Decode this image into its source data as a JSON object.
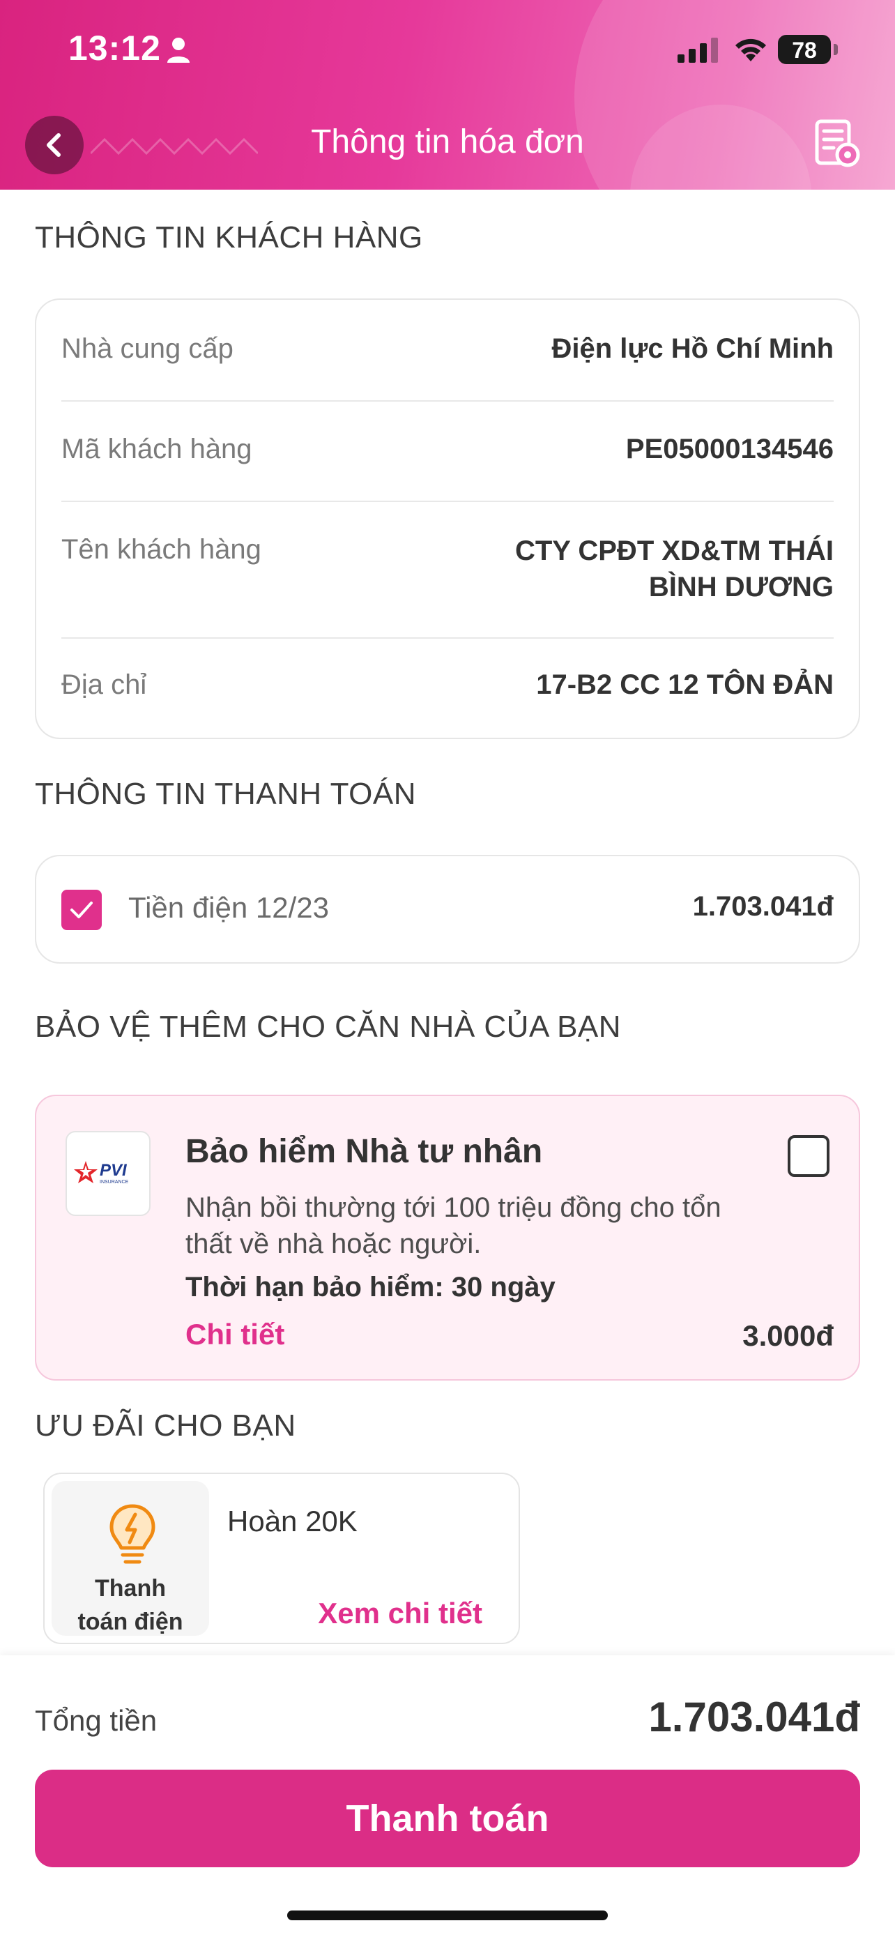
{
  "status_bar": {
    "time": "13:12",
    "battery": "78"
  },
  "header": {
    "title": "Thông tin hóa đơn"
  },
  "customer_section": {
    "title": "THÔNG TIN KHÁCH HÀNG",
    "rows": [
      {
        "label": "Nhà cung cấp",
        "value": "Điện lực Hồ Chí Minh"
      },
      {
        "label": "Mã khách hàng",
        "value": "PE05000134546"
      },
      {
        "label": "Tên khách hàng",
        "value_line1": "CTY CPĐT XD&TM THÁI",
        "value_line2": "BÌNH DƯƠNG"
      },
      {
        "label": "Địa chỉ",
        "value": "17-B2 CC 12 TÔN ĐẢN"
      }
    ]
  },
  "payment_section": {
    "title": "THÔNG TIN THANH TOÁN",
    "item": {
      "label": "Tiền điện 12/23",
      "amount": "1.703.041đ",
      "checked": true
    }
  },
  "insurance_section": {
    "title": "BẢO VỆ THÊM CHO CĂN NHÀ CỦA BẠN",
    "card": {
      "logo_text": "PVI",
      "logo_sub": "INSURANCE",
      "title": "Bảo hiểm Nhà tư nhân",
      "desc_line1": "Nhận bồi thường tới 100 triệu đồng cho tổn",
      "desc_line2": "thất về nhà hoặc người.",
      "term": "Thời hạn bảo hiểm: 30 ngày",
      "detail_link": "Chi tiết",
      "price": "3.000đ",
      "checked": false
    }
  },
  "offers_section": {
    "title": "ƯU ĐÃI CHO BẠN",
    "offer": {
      "tile_line1": "Thanh",
      "tile_line2": "toán điện",
      "title": "Hoàn 20K",
      "link": "Xem chi tiết"
    }
  },
  "footer": {
    "total_label": "Tổng tiền",
    "total_amount": "1.703.041đ",
    "pay_button": "Thanh toán"
  },
  "colors": {
    "brand": "#e0308c",
    "header_gradient_start": "#d9237f",
    "insurance_bg": "#fff0f6"
  }
}
